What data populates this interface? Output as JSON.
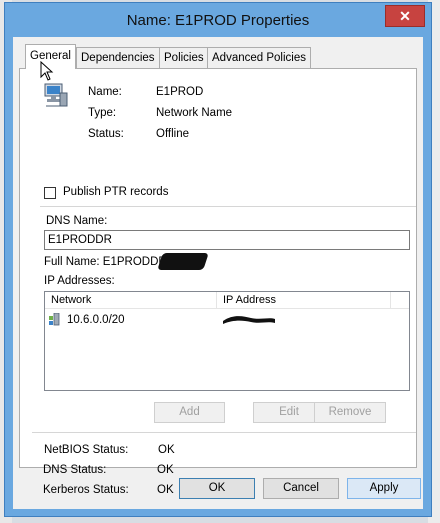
{
  "window": {
    "title": "Name: E1PROD Properties",
    "close_glyph": "✕"
  },
  "tabs": [
    {
      "label": "General",
      "active": true
    },
    {
      "label": "Dependencies",
      "active": false
    },
    {
      "label": "Policies",
      "active": false
    },
    {
      "label": "Advanced Policies",
      "active": false
    }
  ],
  "general": {
    "icon": "network-server-icon",
    "name_label": "Name:",
    "name_value": "E1PROD",
    "type_label": "Type:",
    "type_value": "Network Name",
    "status_label": "Status:",
    "status_value": "Offline",
    "publish_ptr_label": "Publish PTR records",
    "publish_ptr_checked": false,
    "dns_name_label": "DNS Name:",
    "dns_name_value": "E1PRODDR",
    "full_name_text": "Full Name: E1PRODDR.",
    "ip_addresses_label": "IP Addresses:",
    "ip_table": {
      "columns": [
        "Network",
        "IP Address"
      ],
      "rows": [
        {
          "network": "10.6.0.0/20",
          "ip_address": ""
        }
      ]
    },
    "add_label": "Add",
    "edit_label": "Edit",
    "remove_label": "Remove",
    "netbios_label": "NetBIOS Status:",
    "netbios_value": "OK",
    "dns_status_label": "DNS Status:",
    "dns_status_value": "OK",
    "kerberos_label": "Kerberos Status:",
    "kerberos_value": "OK"
  },
  "footer": {
    "ok_label": "OK",
    "cancel_label": "Cancel",
    "apply_label": "Apply"
  },
  "colors": {
    "titlebar": "#6aa8e0",
    "close": "#c74340",
    "window_bg": "#f0f0f0"
  }
}
